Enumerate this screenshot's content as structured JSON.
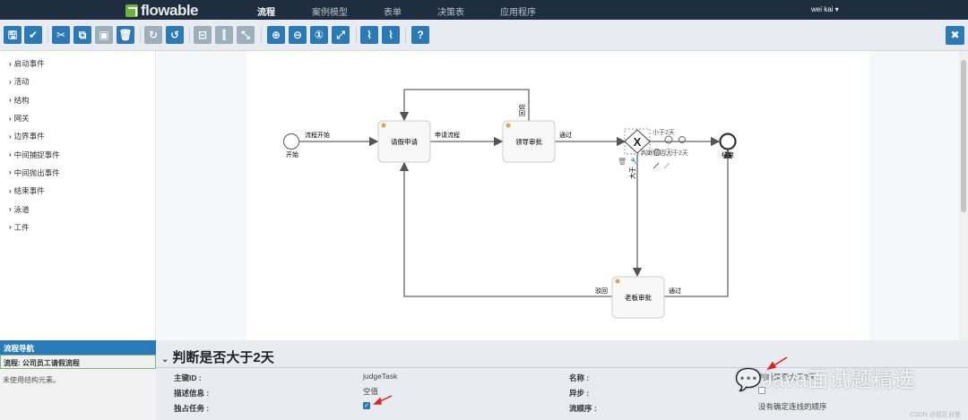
{
  "nav": {
    "logo": "flowable",
    "items": [
      "流程",
      "案例模型",
      "表单",
      "决策表",
      "应用程序"
    ],
    "active": 0,
    "user": "wei kai"
  },
  "toolbar": {
    "buttons": [
      "save-icon",
      "validate-icon",
      "cut-icon",
      "copy-icon",
      "paste-icon",
      "delete-icon",
      "redo-icon",
      "undo-icon",
      "align-horizontal-icon",
      "align-vertical-icon",
      "same-size-icon",
      "zoom-in-icon",
      "zoom-out-icon",
      "zoom-actual-icon",
      "zoom-fit-icon",
      "add-bendpoint-icon",
      "remove-bendpoint-icon",
      "help-icon"
    ],
    "close": "close-icon"
  },
  "palette": {
    "items": [
      "启动事件",
      "活动",
      "结构",
      "网关",
      "边界事件",
      "中间捕捉事件",
      "中间抛出事件",
      "结束事件",
      "泳道",
      "工件"
    ]
  },
  "diagram": {
    "start_label": "开始",
    "end_label": "结束",
    "tasks": [
      "请假申请",
      "领导审批",
      "老板审批"
    ],
    "flows": {
      "start_to_apply": "流程开始",
      "apply_to_leader": "申请流程",
      "leader_pass": "通过",
      "leader_reject": "驳回",
      "gt_two_days": "大于",
      "lt_two_days": "小于2天",
      "boss_reject": "驳回",
      "boss_pass": "通过"
    },
    "gateway_label": "判断是否大于2天"
  },
  "nav_panel": {
    "title": "流程导航",
    "process": "流程: 公司员工请假流程",
    "note": "未使用结构元素。"
  },
  "properties": {
    "title": "判断是否大于2天",
    "id_label": "主键ID :",
    "id_value": "judgeTask",
    "desc_label": "描述信息 :",
    "desc_value": "空值",
    "exclusive_label": "独占任务 :",
    "exclusive_checked": true,
    "name_label": "名称 :",
    "name_value": "判断是否大于2天",
    "async_label": "异步 :",
    "async_checked": false,
    "order_label": "流顺序 :",
    "order_value": "没有确定连线的顺序"
  },
  "watermark": "Java面试题精选",
  "credit": "CSDN @狐臣自傲",
  "colors": {
    "nav": "#1f2d40",
    "accent": "#2a7ab8",
    "logo": "#6db33f",
    "annotation": "#e02020"
  }
}
